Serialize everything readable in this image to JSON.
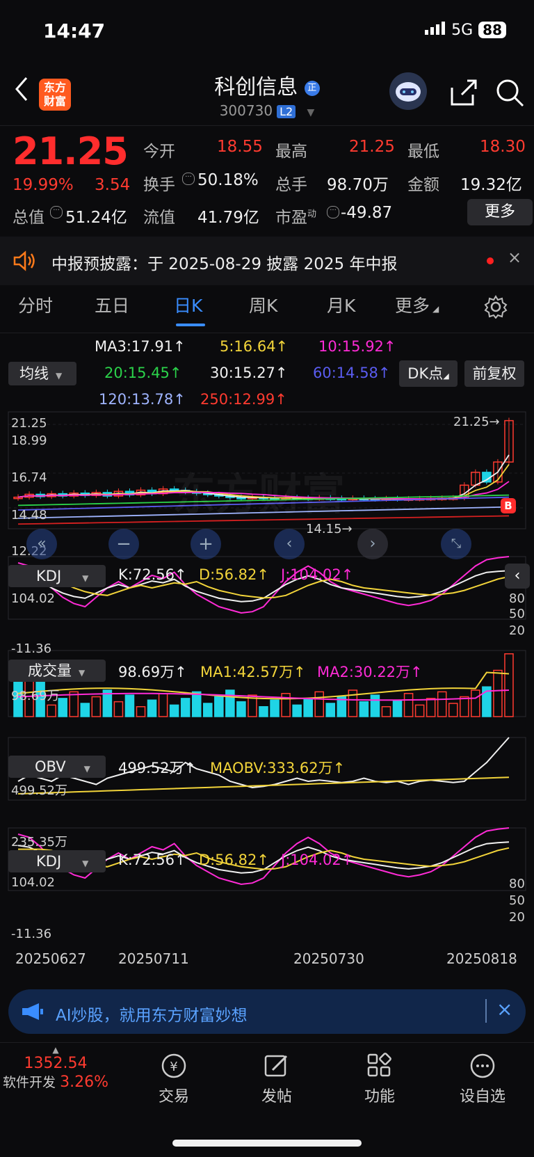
{
  "status": {
    "time": "14:47",
    "network": "5G",
    "battery": "88"
  },
  "header": {
    "title": "科创信息",
    "code": "300730",
    "level": "L2",
    "logo": "东方财富"
  },
  "quote": {
    "price": "21.25",
    "pct": "19.99%",
    "change": "3.54",
    "open_label": "今开",
    "open": "18.55",
    "high_label": "最高",
    "high": "21.25",
    "low_label": "最低",
    "low": "18.30",
    "turnover_label": "换手",
    "turnover": "50.18%",
    "volume_label": "总手",
    "volume": "98.70万",
    "amount_label": "金额",
    "amount": "19.32亿",
    "mcap_label": "总值",
    "mcap": "51.24亿",
    "float_label": "流值",
    "float": "41.79亿",
    "pe_label": "市盈",
    "pe_sup": "动",
    "pe": "-49.87",
    "more": "更多"
  },
  "notice": {
    "text": "中报预披露：于 2025-08-29 披露 2025 年中报"
  },
  "tabs": [
    "分时",
    "五日",
    "日K",
    "周K",
    "月K",
    "更多"
  ],
  "ma": {
    "selector": "均线",
    "dk": "DK点",
    "fq": "前复权",
    "ma3": "MA3:17.91↑",
    "ma5": "5:16.64↑",
    "ma10": "10:15.92↑",
    "ma20": "20:15.45↑",
    "ma30": "30:15.27↑",
    "ma60": "60:14.58↑",
    "ma120": "120:13.78↑",
    "ma250": "250:12.99↑"
  },
  "kline": {
    "y_labels": [
      "21.25",
      "18.99",
      "16.74",
      "14.48",
      "12.22"
    ],
    "max_label": "21.25",
    "min_label": "14.15",
    "watermark": "东方财富",
    "b_marker": "B"
  },
  "kdj": {
    "selector": "KDJ",
    "k": "K:72.56↑",
    "d": "D:56.82↑",
    "j": "J:104.02↑",
    "top": "104.02",
    "bottom": "-11.36",
    "levels": [
      "80",
      "50",
      "20"
    ]
  },
  "volume": {
    "selector": "成交量",
    "value": "98.69万↑",
    "ma1": "MA1:42.57万↑",
    "ma2": "MA2:30.22万↑",
    "top": "98.69万"
  },
  "obv": {
    "selector": "OBV",
    "value": "499.52万↑",
    "maobv": "MAOBV:333.62万↑",
    "top": "499.52万",
    "bottom": "235.35万"
  },
  "kdj2": {
    "selector": "KDJ",
    "k": "K:72.56↑",
    "d": "D:56.82↑",
    "j": "J:104.02↑",
    "top": "104.02",
    "bottom": "-11.36",
    "levels": [
      "80",
      "50",
      "20"
    ]
  },
  "dates": [
    "20250627",
    "20250711",
    "20250730",
    "20250818"
  ],
  "banner": {
    "text": "AI炒股，就用东方财富妙想"
  },
  "bottom": {
    "index_value": "1352.54",
    "sector": "软件开发",
    "sector_pct": "3.26%",
    "nav": [
      "交易",
      "发帖",
      "功能",
      "设自选"
    ]
  },
  "colors": {
    "up": "#ff3b30",
    "down": "#1fd4e6",
    "yellow": "#f2d43a",
    "magenta": "#ff2bd6"
  }
}
